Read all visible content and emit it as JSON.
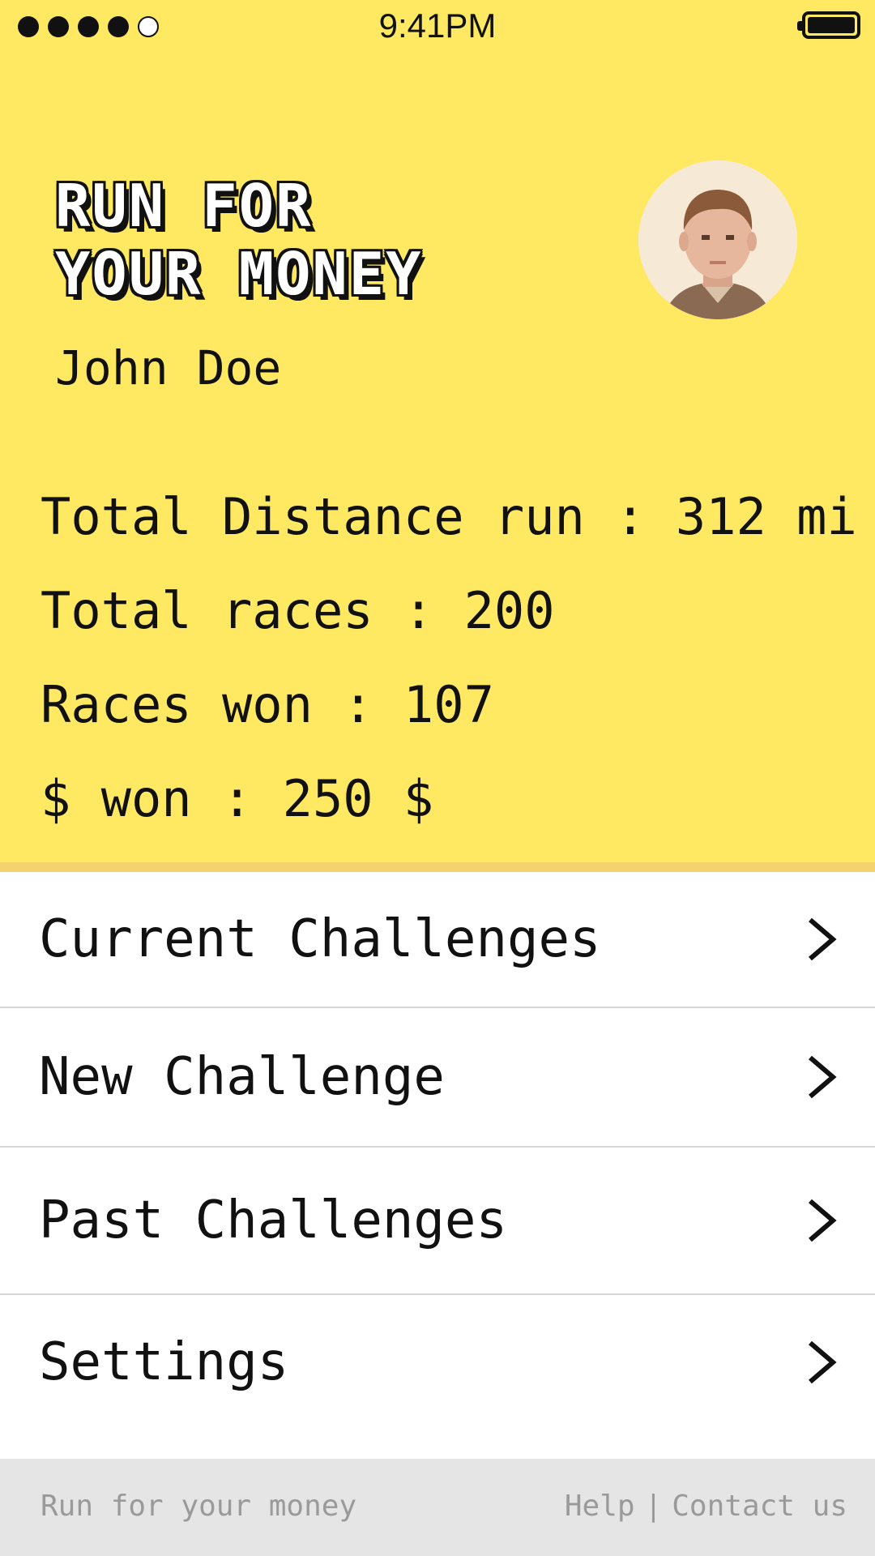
{
  "colors": {
    "header_background": "#ffe963",
    "header_border": "#f4d36e",
    "text": "#111111",
    "divider": "#d6d6d6",
    "footer_background": "#e5e5e5",
    "footer_text": "#9a9a9a"
  },
  "status_bar": {
    "time": "9:41PM",
    "signal_bars_filled": 4,
    "signal_bars_total": 5,
    "battery_level": 1.0
  },
  "header": {
    "title_line1": "RUN FOR",
    "title_line2": "YOUR MONEY",
    "user_name": "John Doe",
    "avatar_icon": "user-avatar"
  },
  "stats": [
    {
      "text": "Total Distance run : 312 mi"
    },
    {
      "text": "Total races : 200"
    },
    {
      "text": "Races won : 107"
    },
    {
      "text": "$ won : 250 $"
    }
  ],
  "menu": [
    {
      "label": "Current Challenges",
      "icon": "chevron-right-icon"
    },
    {
      "label": "New Challenge",
      "icon": "chevron-right-icon"
    },
    {
      "label": "Past Challenges",
      "icon": "chevron-right-icon"
    },
    {
      "label": "Settings",
      "icon": "chevron-right-icon"
    }
  ],
  "footer": {
    "brand": "Run for your money",
    "help": "Help",
    "separator": "|",
    "contact": "Contact us"
  }
}
